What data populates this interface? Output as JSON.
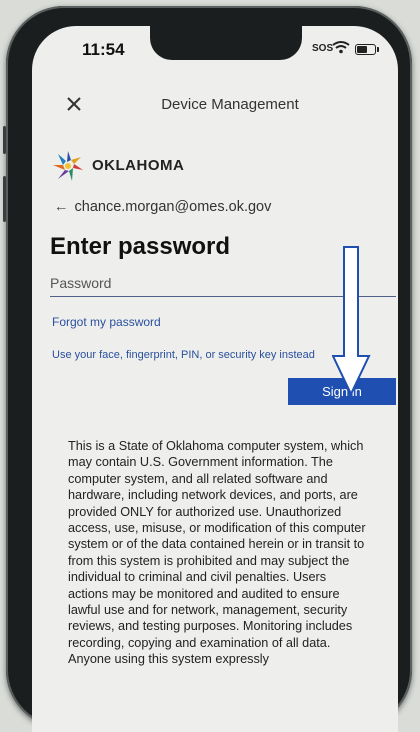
{
  "status_bar": {
    "time": "11:54",
    "sos": "SOS"
  },
  "header": {
    "title": "Device Management",
    "close_icon": "close-icon"
  },
  "brand": {
    "name": "OKLAHOMA",
    "logo_icon": "oklahoma-star-logo"
  },
  "account": {
    "back_icon": "back-arrow-icon",
    "arrow_glyph": "←",
    "email": "chance.morgan@omes.ok.gov"
  },
  "form": {
    "heading": "Enter password",
    "password_placeholder": "Password",
    "forgot_link": "Forgot my password",
    "alt_signin_link": "Use your face, fingerprint, PIN, or security key instead",
    "signin_label": "Sign in"
  },
  "disclaimer": "This is a State of Oklahoma computer system, which may contain U.S. Government information. The computer system, and all related software and hardware, including network devices, and ports, are provided ONLY for authorized use. Unauthorized access, use, misuse, or modification of this computer system or of the data contained herein or in transit to from this system is prohibited and may subject the individual to criminal and civil penalties. Users actions may be monitored and audited to ensure lawful use and for network, management, security reviews, and testing purposes. Monitoring includes recording, copying and examination of all data. Anyone using this system expressly",
  "annotation": {
    "icon": "down-arrow-annotation-icon"
  },
  "colors": {
    "accent": "#1f4fb0",
    "link": "#2a4f9e",
    "screen_bg": "#eeefec"
  }
}
